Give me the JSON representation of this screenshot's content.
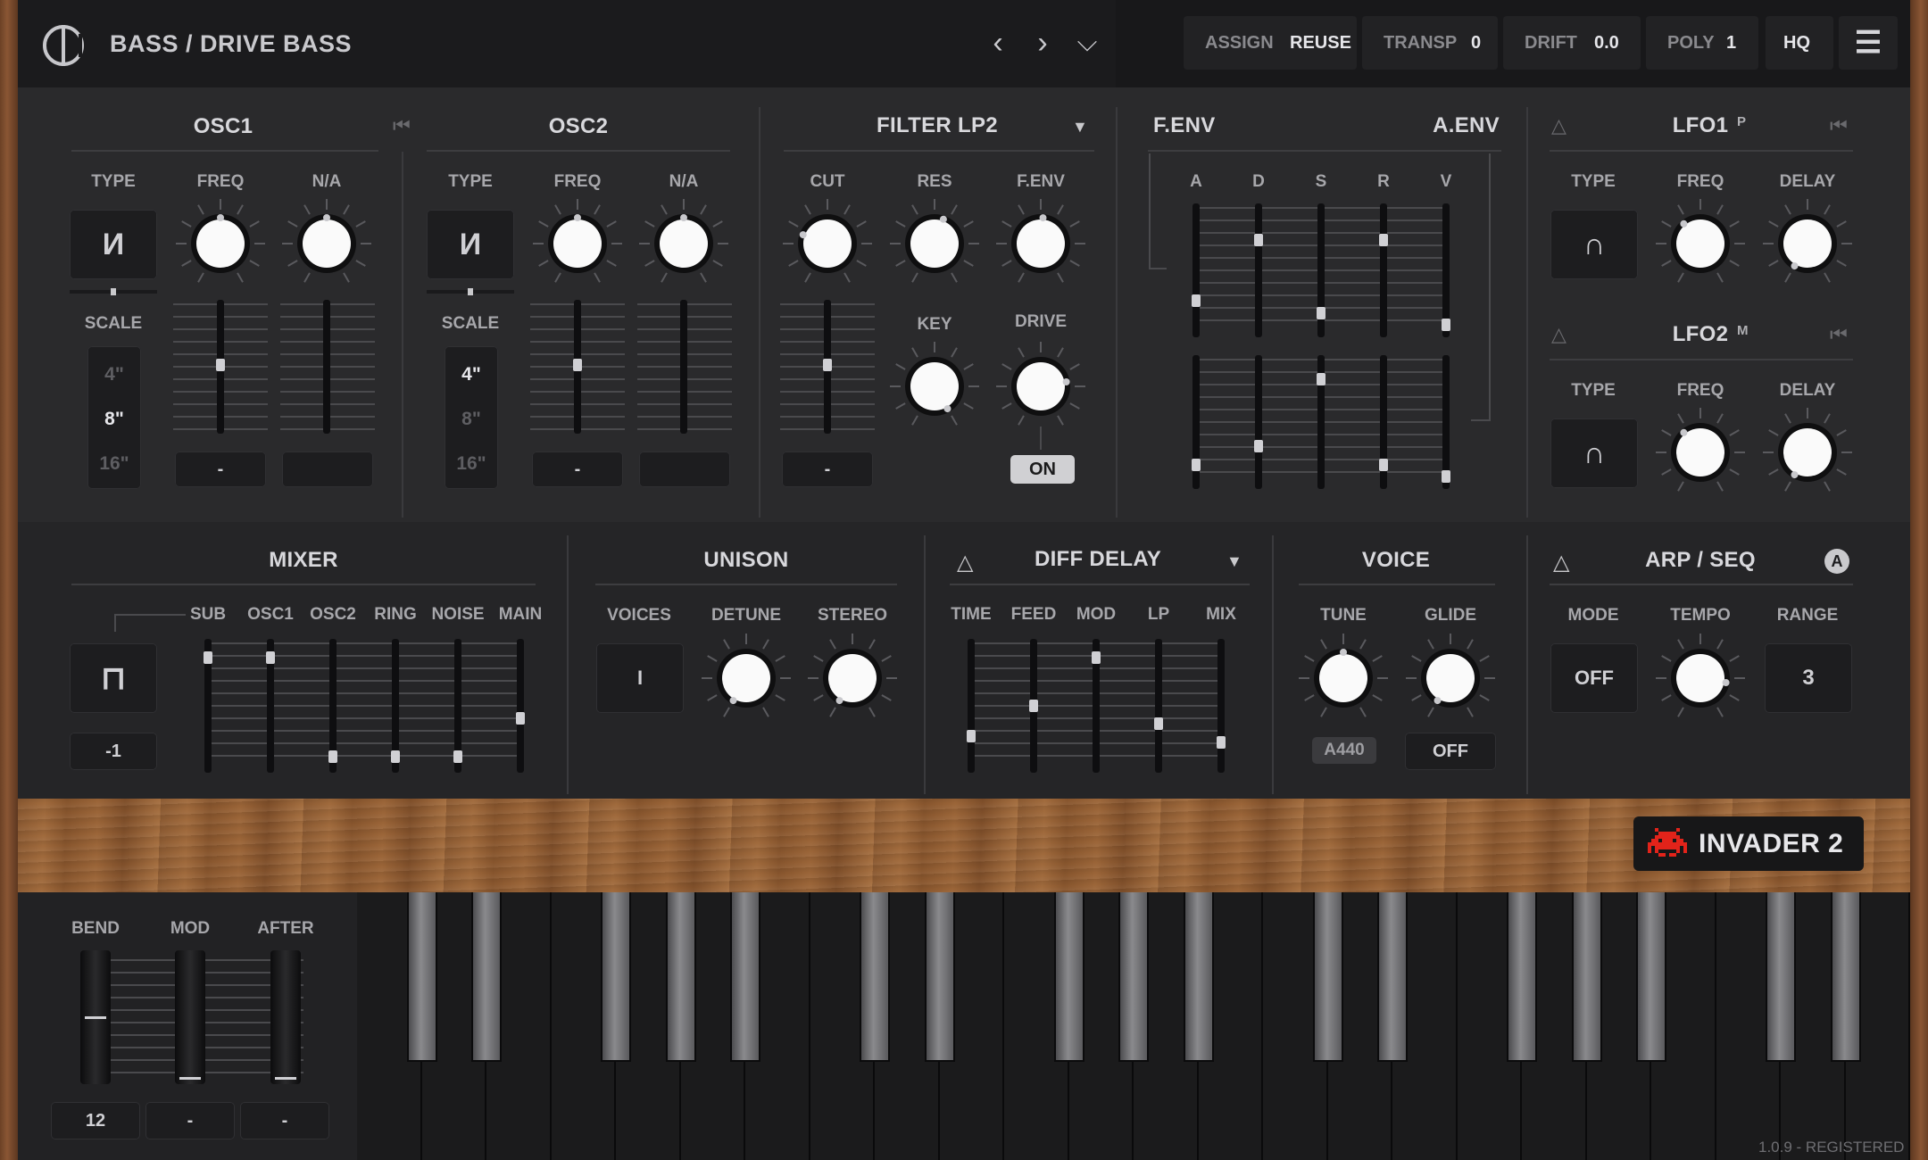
{
  "header": {
    "preset": "BASS / DRIVE BASS",
    "assign_label": "ASSIGN",
    "assign_value": "REUSE",
    "transp_label": "TRANSP",
    "transp_value": "0",
    "drift_label": "DRIFT",
    "drift_value": "0.0",
    "poly_label": "POLY",
    "poly_value": "1",
    "hq_label": "HQ"
  },
  "osc1": {
    "title": "OSC1",
    "type_label": "TYPE",
    "freq_label": "FREQ",
    "na_label": "N/A",
    "scale_label": "SCALE",
    "scale_options": [
      "4\"",
      "8\"",
      "16\""
    ],
    "scale_selected": 1,
    "freq_box": "-",
    "na_box": ""
  },
  "osc2": {
    "title": "OSC2",
    "type_label": "TYPE",
    "freq_label": "FREQ",
    "na_label": "N/A",
    "scale_label": "SCALE",
    "scale_options": [
      "4\"",
      "8\"",
      "16\""
    ],
    "scale_selected": 0,
    "freq_box": "-",
    "na_box": ""
  },
  "filter": {
    "title": "FILTER LP2",
    "cut_label": "CUT",
    "res_label": "RES",
    "fenv_label": "F.ENV",
    "key_label": "KEY",
    "drive_label": "DRIVE",
    "cut_box": "-",
    "drive_state": "ON"
  },
  "env": {
    "fenv_title": "F.ENV",
    "aenv_title": "A.ENV",
    "labels": [
      "A",
      "D",
      "S",
      "R",
      "V"
    ],
    "fenv_levels": [
      0.25,
      0.75,
      0.15,
      0.75,
      0.05
    ],
    "aenv_levels": [
      0.15,
      0.3,
      0.85,
      0.15,
      0.05
    ]
  },
  "lfo1": {
    "title": "LFO1",
    "superscript": "P",
    "type_label": "TYPE",
    "freq_label": "FREQ",
    "delay_label": "DELAY"
  },
  "lfo2": {
    "title": "LFO2",
    "superscript": "M",
    "type_label": "TYPE",
    "freq_label": "FREQ",
    "delay_label": "DELAY"
  },
  "mixer": {
    "title": "MIXER",
    "channels": [
      "SUB",
      "OSC1",
      "OSC2",
      "RING",
      "NOISE",
      "MAIN"
    ],
    "levels": [
      0.9,
      0.9,
      0.08,
      0.08,
      0.08,
      0.4
    ],
    "sub_value": "-1"
  },
  "unison": {
    "title": "UNISON",
    "voices_label": "VOICES",
    "detune_label": "DETUNE",
    "stereo_label": "STEREO",
    "voices_value": "I"
  },
  "delay": {
    "title": "DIFF DELAY",
    "labels": [
      "TIME",
      "FEED",
      "MOD",
      "LP",
      "MIX"
    ],
    "levels": [
      0.25,
      0.5,
      0.9,
      0.35,
      0.2
    ]
  },
  "voice": {
    "title": "VOICE",
    "tune_label": "TUNE",
    "glide_label": "GLIDE",
    "tune_value": "A440",
    "glide_value": "OFF"
  },
  "arp": {
    "title": "ARP / SEQ",
    "mode_label": "MODE",
    "tempo_label": "TEMPO",
    "range_label": "RANGE",
    "mode_value": "OFF",
    "range_value": "3",
    "auto_badge": "A"
  },
  "brand": {
    "name": "INVADER 2"
  },
  "perf": {
    "bend_label": "BEND",
    "mod_label": "MOD",
    "after_label": "AFTER",
    "bend_value": "12",
    "mod_value": "-",
    "after_value": "-"
  },
  "status": {
    "version": "1.0.9 - REGISTERED"
  },
  "colors": {
    "accent": "#e2231a",
    "panel": "#2a2a2c",
    "text": "#c9c9cc"
  }
}
